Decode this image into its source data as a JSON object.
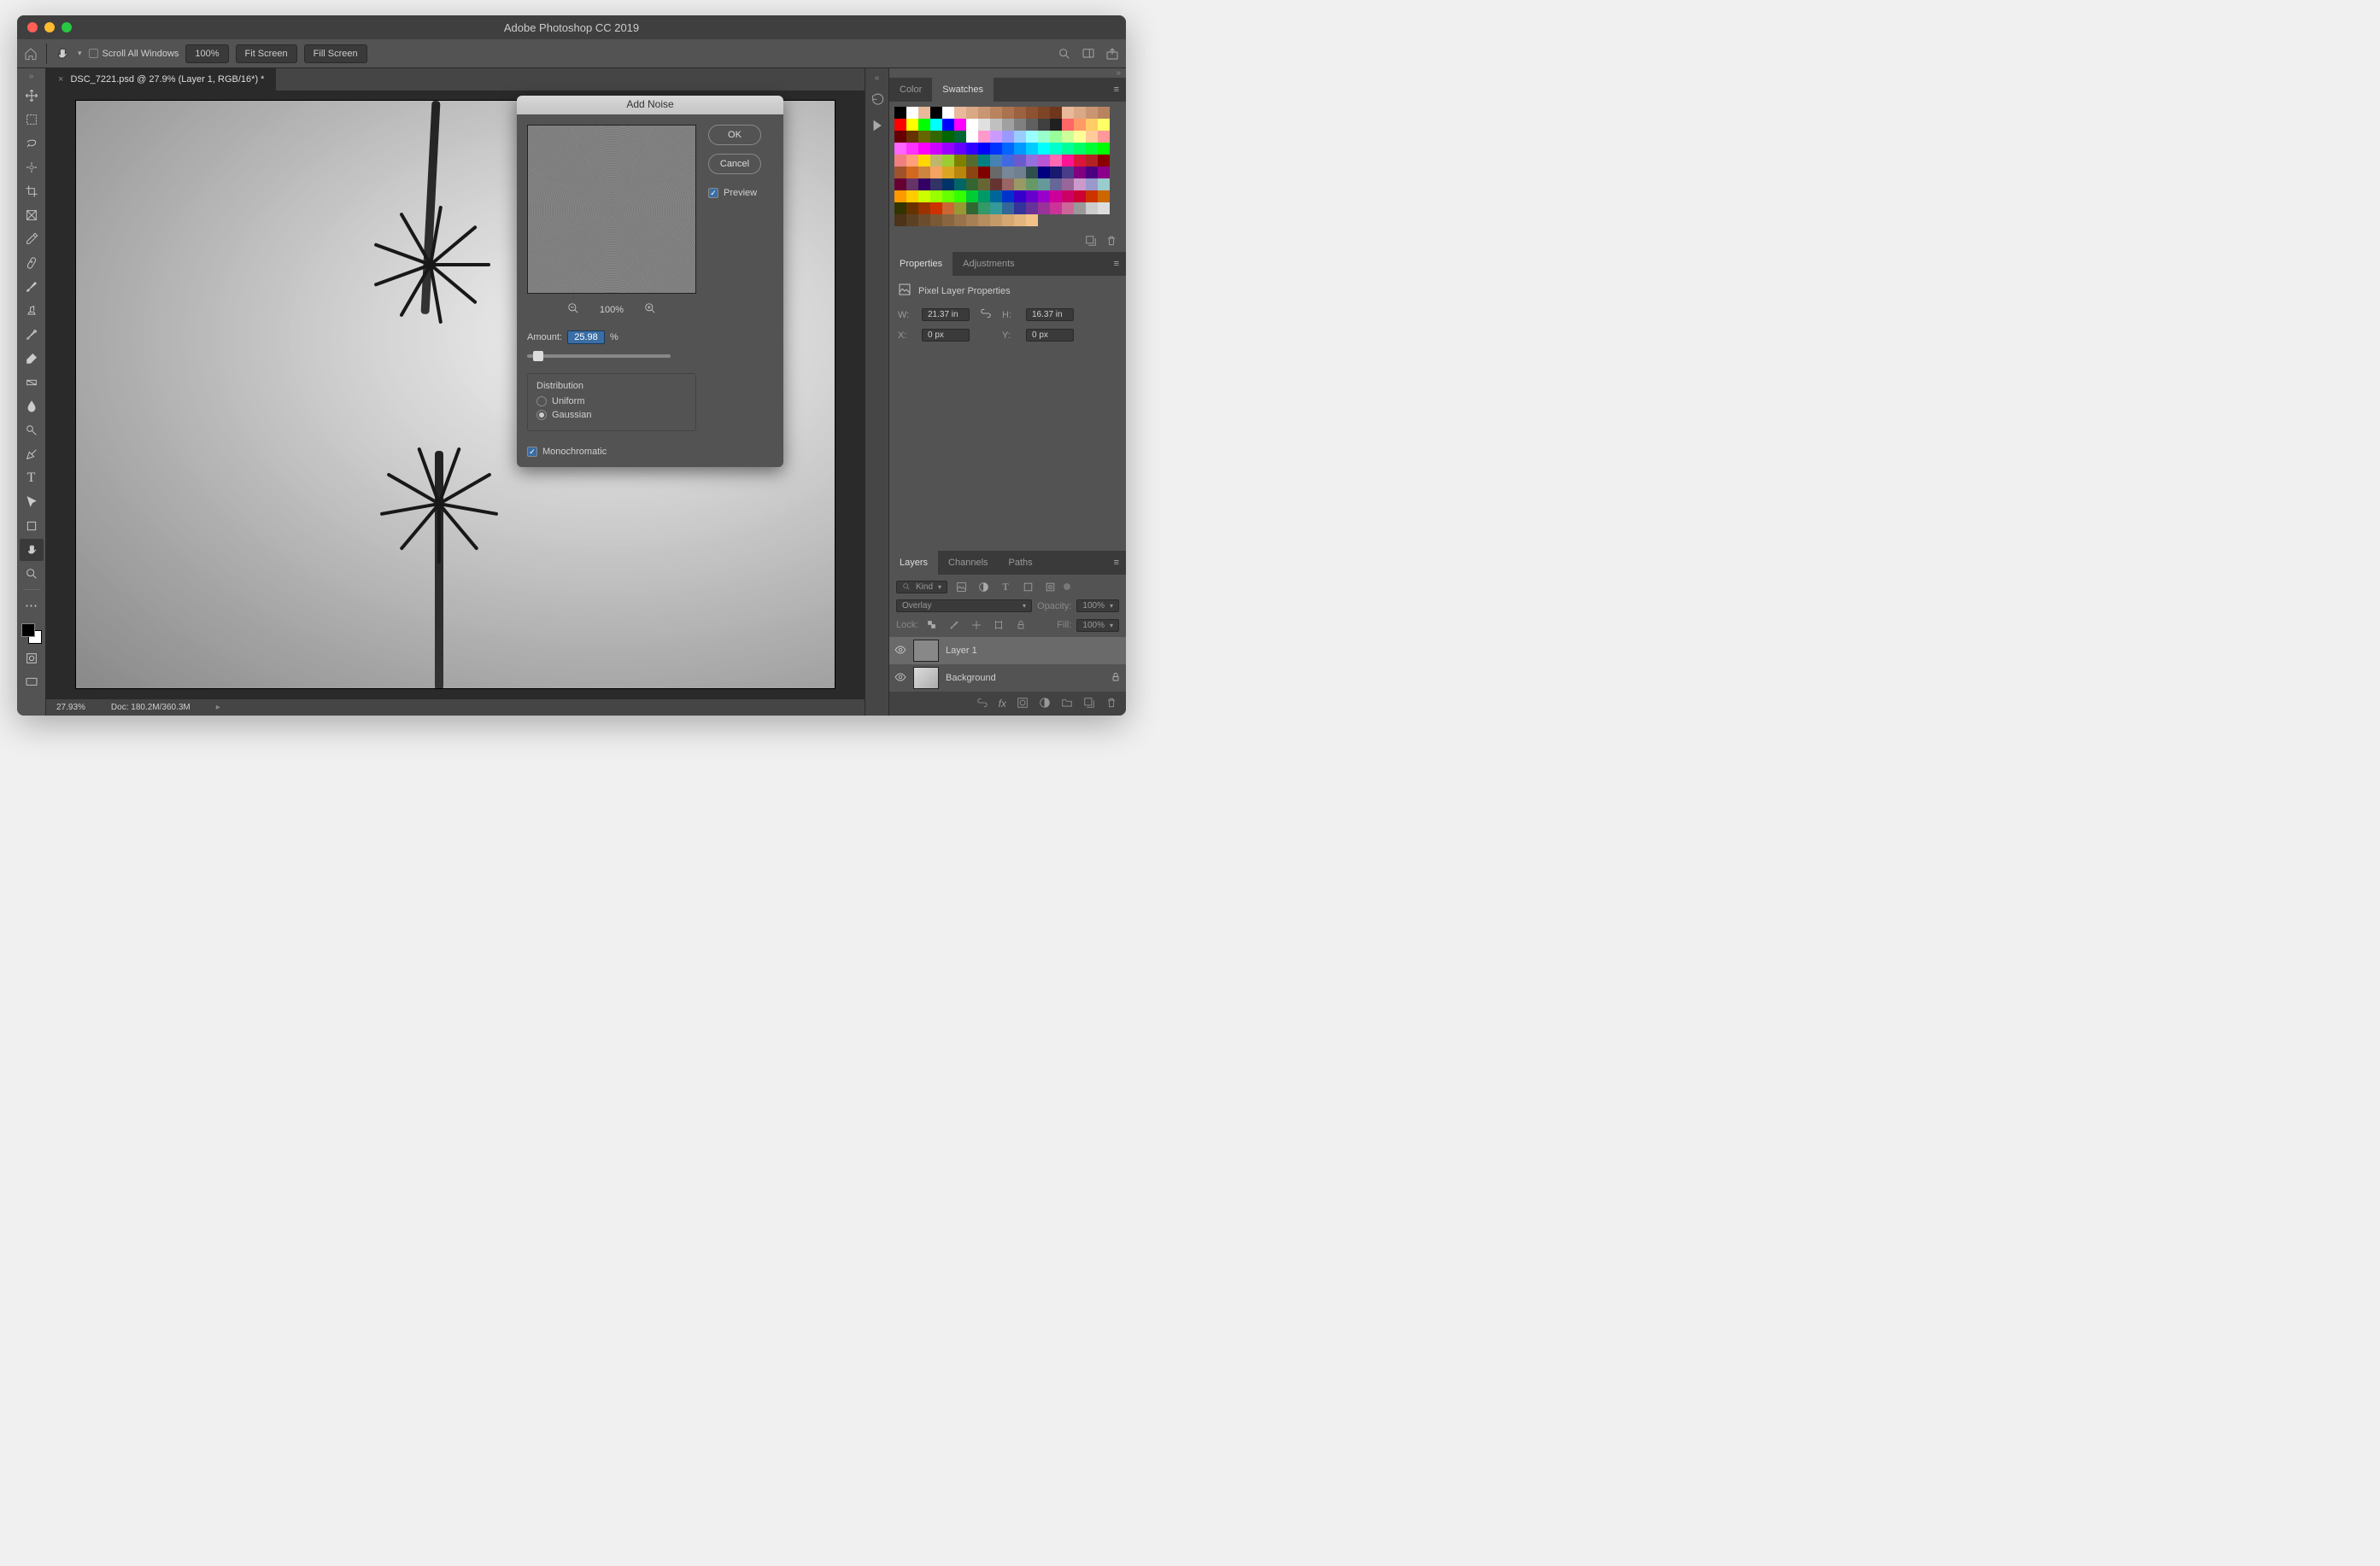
{
  "app_title": "Adobe Photoshop CC 2019",
  "options_bar": {
    "scroll_all_label": "Scroll All Windows",
    "zoom": "100%",
    "fit_screen": "Fit Screen",
    "fill_screen": "Fill Screen"
  },
  "document": {
    "tab_title": "DSC_7221.psd @ 27.9% (Layer 1, RGB/16*) *",
    "status_zoom": "27.93%",
    "status_doc": "Doc: 180.2M/360.3M"
  },
  "dialog": {
    "title": "Add Noise",
    "ok": "OK",
    "cancel": "Cancel",
    "preview_label": "Preview",
    "preview_zoom": "100%",
    "amount_label": "Amount:",
    "amount_value": "25.98",
    "amount_unit": "%",
    "distribution_label": "Distribution",
    "uniform": "Uniform",
    "gaussian": "Gaussian",
    "monochromatic": "Monochromatic"
  },
  "panels": {
    "color_tab": "Color",
    "swatches_tab": "Swatches",
    "properties_tab": "Properties",
    "adjustments_tab": "Adjustments",
    "layers_tab": "Layers",
    "channels_tab": "Channels",
    "paths_tab": "Paths"
  },
  "properties": {
    "header": "Pixel Layer Properties",
    "w_label": "W:",
    "w_value": "21.37 in",
    "h_label": "H:",
    "h_value": "16.37 in",
    "x_label": "X:",
    "x_value": "0 px",
    "y_label": "Y:",
    "y_value": "0 px"
  },
  "layers": {
    "kind": "Kind",
    "blend": "Overlay",
    "opacity_label": "Opacity:",
    "opacity_value": "100%",
    "lock_label": "Lock:",
    "fill_label": "Fill:",
    "fill_value": "100%",
    "layer1": "Layer 1",
    "background": "Background"
  },
  "swatch_rows": [
    [
      "#000000",
      "#ffffff",
      "#e8b99a",
      "#000000",
      "#ffffff",
      "#e8b99a",
      "#d9a884",
      "#c99572",
      "#b98360",
      "#aa724f",
      "#9b6140",
      "#8c5232",
      "#7d4426",
      "#6e371b",
      "#e8b99a",
      "#d9a884",
      "#c99572",
      "#b98360"
    ],
    [
      "#ff0000",
      "#ffff00",
      "#00ff00",
      "#00ffff",
      "#0000ff",
      "#ff00ff",
      "#ffffff",
      "#e0e0e0",
      "#c0c0c0",
      "#a0a0a0",
      "#808080",
      "#606060",
      "#404040",
      "#202020",
      "#ff6666",
      "#ff9966",
      "#ffcc66",
      "#ffff66"
    ],
    [
      "#660000",
      "#663300",
      "#666600",
      "#336600",
      "#006600",
      "#006633",
      "#ffffff",
      "#ff99cc",
      "#cc99ff",
      "#9999ff",
      "#99ccff",
      "#99ffff",
      "#99ffcc",
      "#99ff99",
      "#ccff99",
      "#ffff99",
      "#ffcc99",
      "#ff9999"
    ],
    [
      "#ff66ff",
      "#ff33ff",
      "#ff00ff",
      "#cc00ff",
      "#9900ff",
      "#6600ff",
      "#3300ff",
      "#0000ff",
      "#0033ff",
      "#0066ff",
      "#0099ff",
      "#00ccff",
      "#00ffff",
      "#00ffcc",
      "#00ff99",
      "#00ff66",
      "#00ff33",
      "#00ff00"
    ],
    [
      "#f08080",
      "#ffa07a",
      "#ffd700",
      "#bdb76b",
      "#9acd32",
      "#808000",
      "#556b2f",
      "#008080",
      "#4682b4",
      "#4169e1",
      "#6a5acd",
      "#9370db",
      "#ba55d3",
      "#ff69b4",
      "#ff1493",
      "#dc143c",
      "#b22222",
      "#8b0000"
    ],
    [
      "#a0522d",
      "#d2691e",
      "#cd853f",
      "#f4a460",
      "#daa520",
      "#b8860b",
      "#8b4513",
      "#800000",
      "#696969",
      "#778899",
      "#708090",
      "#2f4f4f",
      "#000080",
      "#191970",
      "#483d8b",
      "#800080",
      "#4b0082",
      "#8b008b"
    ],
    [
      "#660033",
      "#663366",
      "#330066",
      "#333366",
      "#003366",
      "#006666",
      "#336633",
      "#666633",
      "#663333",
      "#996666",
      "#999966",
      "#669966",
      "#669999",
      "#666699",
      "#996699",
      "#cc99cc",
      "#9999cc",
      "#99cccc"
    ],
    [
      "#ff9900",
      "#ffcc00",
      "#ccff00",
      "#99ff00",
      "#66ff00",
      "#33ff00",
      "#00cc33",
      "#009966",
      "#006699",
      "#0033cc",
      "#3300cc",
      "#6600cc",
      "#9900cc",
      "#cc0099",
      "#cc0066",
      "#cc0033",
      "#cc3300",
      "#cc6600"
    ],
    [
      "#333300",
      "#663300",
      "#993300",
      "#cc3300",
      "#cc6633",
      "#999933",
      "#336633",
      "#339966",
      "#339999",
      "#336699",
      "#333399",
      "#663399",
      "#993399",
      "#cc3399",
      "#cc6699",
      "#999999",
      "#cccccc",
      "#dddddd"
    ],
    [
      "#4d3319",
      "#5c4023",
      "#6b4c2d",
      "#7a5937",
      "#896641",
      "#98734b",
      "#a78055",
      "#b68d5f",
      "#c59a69",
      "#d4a773",
      "#e3b47d",
      "#f2c187"
    ]
  ]
}
